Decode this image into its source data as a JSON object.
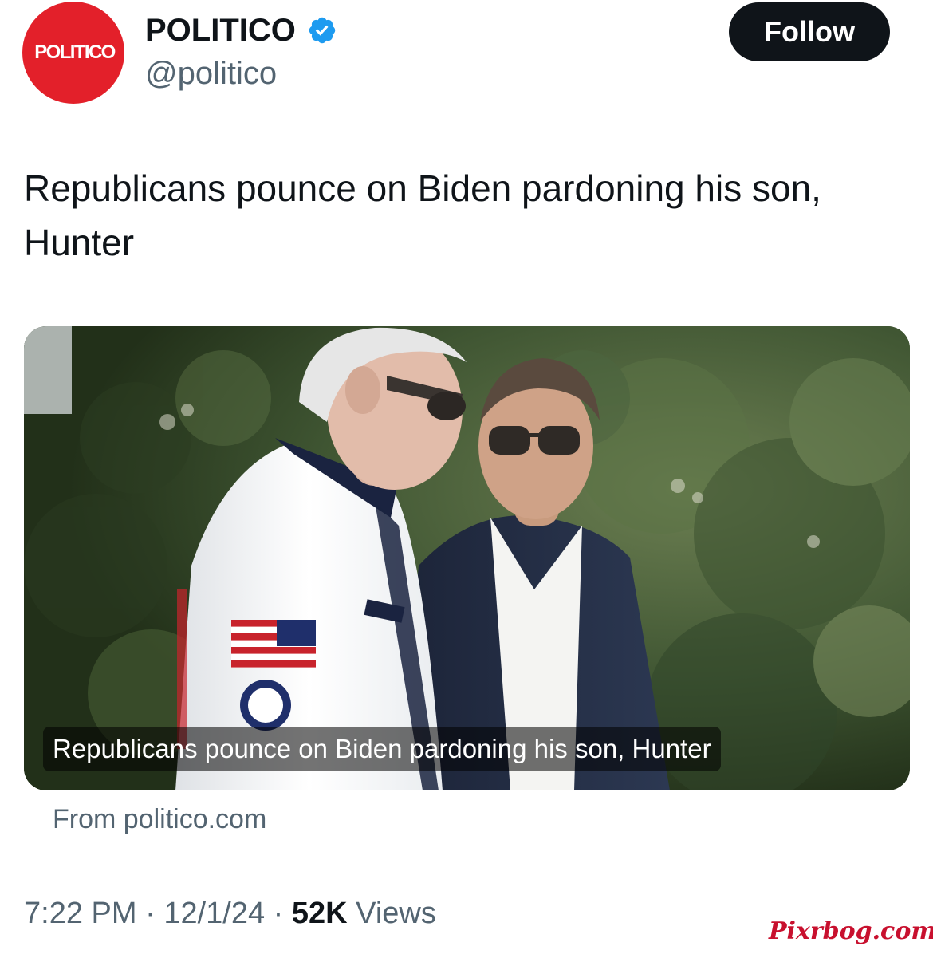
{
  "header": {
    "avatar_text": "POLITICO",
    "display_name": "POLITICO",
    "handle": "@politico",
    "follow_label": "Follow"
  },
  "tweet": {
    "text": "Republicans pounce on Biden pardoning his son, Hunter"
  },
  "card": {
    "caption": "Republicans pounce on Biden pardoning his son, Hunter",
    "source": "From politico.com"
  },
  "meta": {
    "time": "7:22 PM",
    "separator": "·",
    "date": "12/1/24",
    "views_count": "52K",
    "views_label": "Views"
  },
  "watermark": "Pixrbog.com",
  "colors": {
    "avatar_bg": "#e3202a",
    "verified": "#1d9bf0",
    "follow_bg": "#0f1419",
    "secondary_text": "#536471",
    "watermark": "#c8102e"
  },
  "icons": {
    "verified": "verified-badge-icon"
  }
}
